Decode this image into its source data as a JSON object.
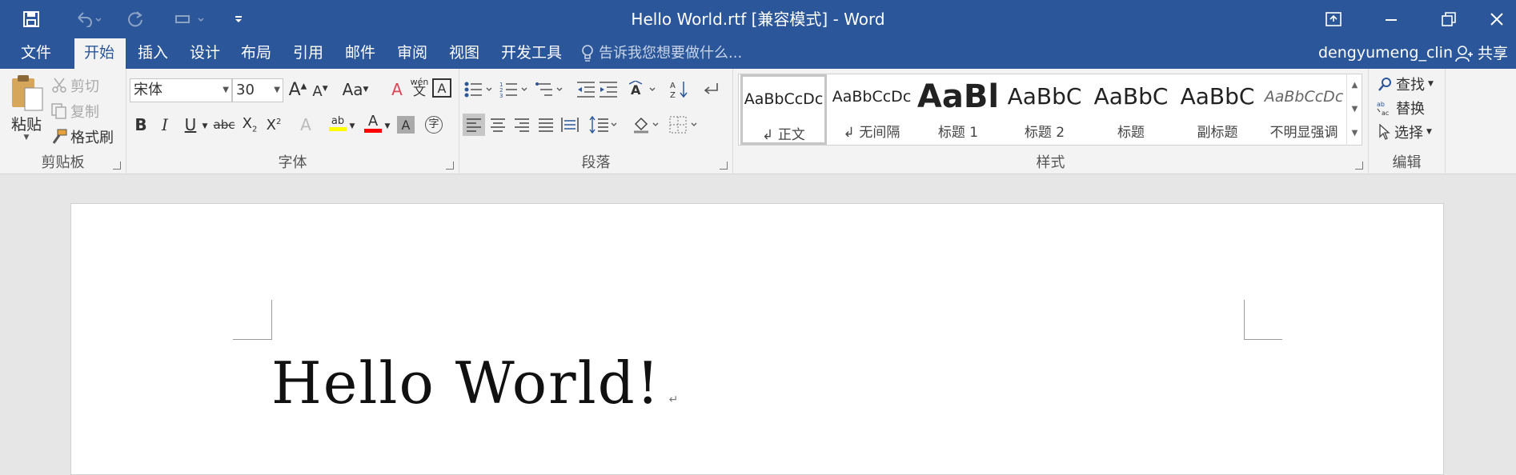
{
  "window": {
    "title": "Hello World.rtf [兼容模式] - Word"
  },
  "qat": {
    "save": "save-icon",
    "undo": "undo-icon",
    "redo": "redo-icon",
    "touch": "touch-mode-icon",
    "customize": "customize-qat-icon"
  },
  "tabs": [
    {
      "label": "文件"
    },
    {
      "label": "开始"
    },
    {
      "label": "插入"
    },
    {
      "label": "设计"
    },
    {
      "label": "布局"
    },
    {
      "label": "引用"
    },
    {
      "label": "邮件"
    },
    {
      "label": "审阅"
    },
    {
      "label": "视图"
    },
    {
      "label": "开发工具"
    }
  ],
  "tell_me": "告诉我您想要做什么...",
  "user": "dengyumeng_clin",
  "share": "共享",
  "clipboard": {
    "paste": "粘贴",
    "cut": "剪切",
    "copy": "复制",
    "format_painter": "格式刷",
    "label": "剪贴板"
  },
  "font": {
    "name": "宋体",
    "size": "30",
    "label": "字体",
    "change_case": "Aa",
    "phonetic": "wén"
  },
  "paragraph": {
    "label": "段落"
  },
  "styles": {
    "label": "样式",
    "items": [
      {
        "sample": "AaBbCcDc",
        "name": "↲ 正文"
      },
      {
        "sample": "AaBbCcDc",
        "name": "↲ 无间隔"
      },
      {
        "sample": "AaBl",
        "name": "标题 1"
      },
      {
        "sample": "AaBbC",
        "name": "标题 2"
      },
      {
        "sample": "AaBbC",
        "name": "标题"
      },
      {
        "sample": "AaBbC",
        "name": "副标题"
      },
      {
        "sample": "AaBbCcDc",
        "name": "不明显强调"
      }
    ]
  },
  "editing": {
    "find": "查找",
    "replace": "替换",
    "select": "选择",
    "label": "编辑"
  },
  "document": {
    "text": "Hello World!",
    "para_mark": "↵"
  },
  "colors": {
    "accent": "#2b579a",
    "highlight": "#ffff00",
    "font_color": "#ff0000"
  }
}
